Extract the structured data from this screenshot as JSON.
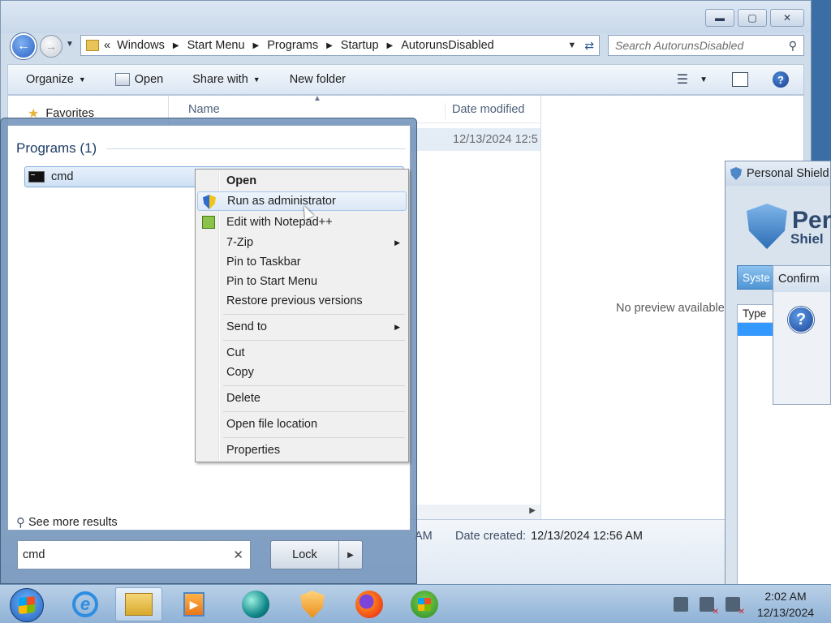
{
  "explorer": {
    "window_buttons": {
      "minimize": "▬",
      "maximize": "▢",
      "close": "✕"
    },
    "address": {
      "prefix": "«",
      "crumbs": [
        "Windows",
        "Start Menu",
        "Programs",
        "Startup",
        "AutorunsDisabled"
      ]
    },
    "search_placeholder": "Search AutorunsDisabled",
    "toolbar": {
      "organize": "Organize",
      "open": "Open",
      "share_with": "Share with",
      "new_folder": "New folder"
    },
    "nav": {
      "favorites": "Favorites"
    },
    "columns": {
      "name": "Name",
      "date_modified": "Date modified"
    },
    "file_row": {
      "date_modified": "12/13/2024 12:5"
    },
    "preview_text": "No preview available",
    "details": {
      "time_fragment": "AM",
      "date_created_label": "Date created:",
      "date_created_value": "12/13/2024 12:56 AM"
    }
  },
  "personal_shield": {
    "title": "Personal Shield",
    "brand_line1": "Per",
    "brand_line2": "Shiel",
    "tab": "Syste",
    "list_header": "Type"
  },
  "confirm": {
    "title": "Confirm",
    "icon": "?"
  },
  "start_menu": {
    "heading": "Programs (1)",
    "result": "cmd",
    "see_more": "See more results",
    "search_value": "cmd",
    "lock_label": "Lock"
  },
  "context_menu": {
    "items": [
      {
        "label": "Open"
      },
      {
        "label": "Run as administrator"
      },
      {
        "label": "Edit with Notepad++"
      },
      {
        "label": "7-Zip"
      },
      {
        "label": "Pin to Taskbar"
      },
      {
        "label": "Pin to Start Menu"
      },
      {
        "label": "Restore previous versions"
      },
      {
        "label": "Send to"
      },
      {
        "label": "Cut"
      },
      {
        "label": "Copy"
      },
      {
        "label": "Delete"
      },
      {
        "label": "Open file location"
      },
      {
        "label": "Properties"
      }
    ]
  },
  "taskbar": {
    "apps": [
      "start-orb",
      "internet-explorer-icon",
      "windows-explorer-icon",
      "media-player-icon",
      "globe-app-icon",
      "shield-app-icon",
      "firefox-icon",
      "windows-update-icon"
    ],
    "clock": {
      "time": "2:02 AM",
      "date": "12/13/2024"
    }
  }
}
